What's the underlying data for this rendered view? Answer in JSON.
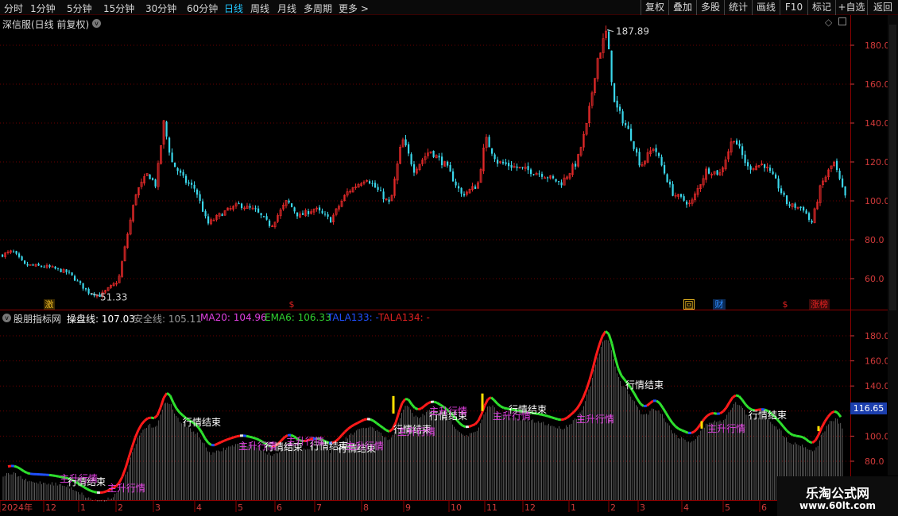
{
  "toolbar": {
    "periods": [
      "分时",
      "1分钟",
      "5分钟",
      "15分钟",
      "30分钟",
      "60分钟",
      "日线",
      "周线",
      "月线",
      "多周期",
      "更多 >"
    ],
    "active_period": "日线",
    "tools": [
      "复权",
      "叠加",
      "多股",
      "统计",
      "画线",
      "F10",
      "标记",
      "+自选",
      "返回"
    ]
  },
  "main_chart": {
    "title": "深信服(日线 前复权)",
    "high_label": "187.89",
    "low_label": "51.33",
    "y_ticks": [
      "180.0",
      "160.0",
      "140.0",
      "120.0",
      "100.0",
      "80.0",
      "60.0"
    ],
    "events": [
      {
        "label": "激",
        "color": "#e6b422"
      },
      {
        "label": "$",
        "color": "#e02020"
      },
      {
        "label": "回",
        "color": "#e6b422"
      },
      {
        "label": "财",
        "color": "#2f8cff"
      },
      {
        "label": "$",
        "color": "#e02020"
      },
      {
        "label": "涨榜",
        "color": "#e02020"
      }
    ]
  },
  "indicator": {
    "name": "股朋指标网",
    "items": [
      {
        "text": "操盘线: 107.03",
        "color": "#ffffff"
      },
      {
        "text": "安全线: 105.11",
        "color": "#9a9a9a"
      },
      {
        "text": "MA20: 104.96",
        "color": "#e040e0"
      },
      {
        "text": "EMA6: 106.33",
        "color": "#30d030"
      },
      {
        "text": "TALA133: -",
        "color": "#2050ff"
      },
      {
        "text": "TALA134: -",
        "color": "#e02020"
      }
    ],
    "y_ticks": [
      "180.0",
      "160.0",
      "140.0",
      "120.0",
      "100.0",
      "80.0"
    ],
    "current_value": "116.65",
    "annotations_end": [
      "行情结束",
      "行情结束",
      "行情结束",
      "行情结束",
      "行情结束",
      "行情结束",
      "行情结束",
      "行情结束",
      "行情结束",
      "行情结束"
    ],
    "annotations_start": [
      "主升行情",
      "主升行情",
      "主升行情",
      "主升行情",
      "主升行情",
      "主升行情",
      "主升行情",
      "主升行情",
      "主升行情",
      "主升行情"
    ]
  },
  "x_axis": {
    "labels": [
      "2024年",
      "12",
      "1",
      "2",
      "3",
      "4",
      "5",
      "6",
      "7",
      "8",
      "9",
      "10",
      "11",
      "12",
      "1",
      "2",
      "3",
      "4",
      "5",
      "6"
    ]
  },
  "watermark": {
    "title": "乐淘公式网",
    "url": "www.60lt.com"
  },
  "colors": {
    "up": "#e02828",
    "down": "#3ad6ea",
    "grid": "#6a0000",
    "axis": "#d23a3a"
  }
}
